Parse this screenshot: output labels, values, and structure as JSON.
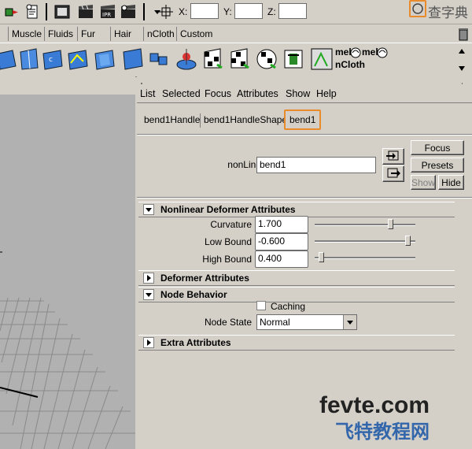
{
  "status_line": {
    "x_label": "X:",
    "y_label": "Y:",
    "z_label": "Z:",
    "x_value": "",
    "y_value": "",
    "z_value": ""
  },
  "shelf_tabs": [
    "Muscle",
    "Fluids",
    "Fur",
    "Hair",
    "nCloth",
    "Custom"
  ],
  "shelf_icons": [
    "mel",
    "mel",
    "nCloth"
  ],
  "attr_menu": [
    "List",
    "Selected",
    "Focus",
    "Attributes",
    "Show",
    "Help"
  ],
  "tabs": [
    "bend1Handle",
    "bend1HandleShape",
    "bend1"
  ],
  "node": {
    "label": "nonLinear:",
    "value": "bend1"
  },
  "side_buttons": {
    "focus": "Focus",
    "presets": "Presets",
    "show": "Show",
    "hide": "Hide"
  },
  "sections": {
    "nonlinear": "Nonlinear Deformer Attributes",
    "deformer": "Deformer Attributes",
    "node_behavior": "Node Behavior",
    "extra": "Extra Attributes"
  },
  "attrs": [
    {
      "label": "Curvature",
      "value": "1.700",
      "fraction": 0.77
    },
    {
      "label": "Low Bound",
      "value": "-0.600",
      "fraction": 0.95
    },
    {
      "label": "High Bound",
      "value": "0.400",
      "fraction": 0.04
    }
  ],
  "node_behavior": {
    "caching_label": "Caching",
    "caching_checked": false,
    "node_state_label": "Node State",
    "node_state_value": "Normal"
  },
  "watermark": {
    "line1": "fevte.com",
    "line2": "飞特教程网",
    "corner": "查字典"
  },
  "colors": {
    "highlight": "#e98a2b",
    "panel": "#d4d0c8",
    "viewport": "#b1b1b1"
  }
}
